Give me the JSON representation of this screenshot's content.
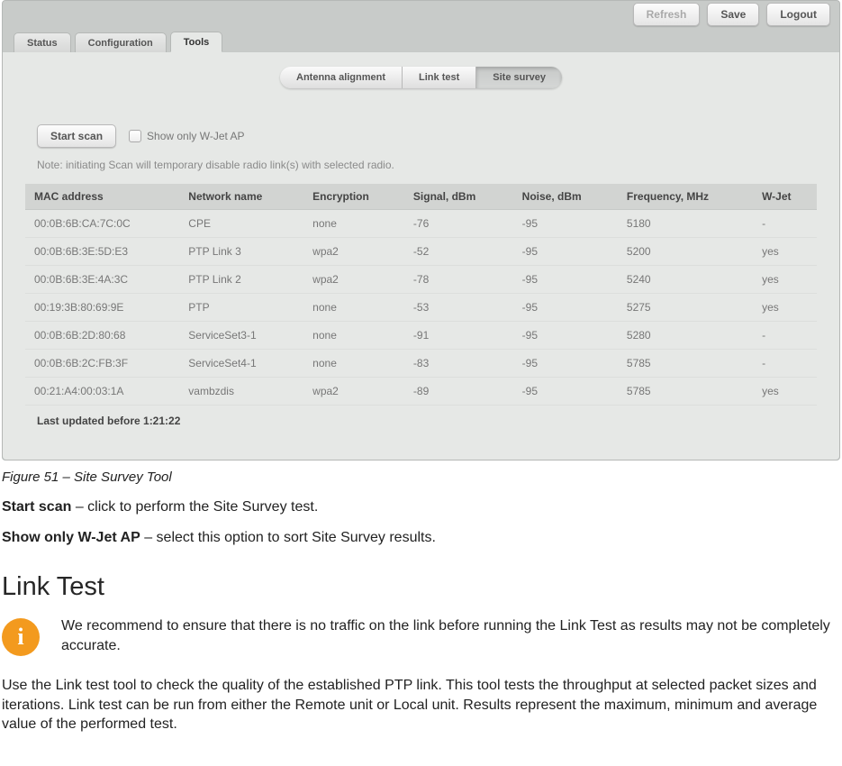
{
  "top_buttons": {
    "refresh": "Refresh",
    "save": "Save",
    "logout": "Logout"
  },
  "main_tabs": {
    "status": "Status",
    "configuration": "Configuration",
    "tools": "Tools"
  },
  "sub_tabs": {
    "antenna": "Antenna alignment",
    "link": "Link test",
    "site": "Site survey"
  },
  "toolbar": {
    "start_scan": "Start scan",
    "show_only_label": "Show only W-Jet AP",
    "note": "Note: initiating Scan will temporary disable radio link(s) with selected radio."
  },
  "headers": {
    "mac": "MAC address",
    "net": "Network name",
    "enc": "Encryption",
    "sig": "Signal, dBm",
    "noise": "Noise, dBm",
    "freq": "Frequency, MHz",
    "wjet": "W-Jet"
  },
  "rows": [
    {
      "mac": "00:0B:6B:CA:7C:0C",
      "net": "CPE",
      "enc": "none",
      "sig": "-76",
      "noise": "-95",
      "freq": "5180",
      "wjet": "-"
    },
    {
      "mac": "00:0B:6B:3E:5D:E3",
      "net": "PTP Link 3",
      "enc": "wpa2",
      "sig": "-52",
      "noise": "-95",
      "freq": "5200",
      "wjet": "yes"
    },
    {
      "mac": "00:0B:6B:3E:4A:3C",
      "net": "PTP Link 2",
      "enc": "wpa2",
      "sig": "-78",
      "noise": "-95",
      "freq": "5240",
      "wjet": "yes"
    },
    {
      "mac": "00:19:3B:80:69:9E",
      "net": "PTP",
      "enc": "none",
      "sig": "-53",
      "noise": "-95",
      "freq": "5275",
      "wjet": "yes"
    },
    {
      "mac": "00:0B:6B:2D:80:68",
      "net": "ServiceSet3-1",
      "enc": "none",
      "sig": "-91",
      "noise": "-95",
      "freq": "5280",
      "wjet": "-"
    },
    {
      "mac": "00:0B:6B:2C:FB:3F",
      "net": "ServiceSet4-1",
      "enc": "none",
      "sig": "-83",
      "noise": "-95",
      "freq": "5785",
      "wjet": "-"
    },
    {
      "mac": "00:21:A4:00:03:1A",
      "net": "vambzdis",
      "enc": "wpa2",
      "sig": "-89",
      "noise": "-95",
      "freq": "5785",
      "wjet": "yes"
    }
  ],
  "last_updated": "Last updated before 1:21:22",
  "caption": "Figure 51 – Site Survey Tool",
  "desc": {
    "start_scan_bold": "Start scan",
    "start_scan_rest": " – click to perform the Site Survey test.",
    "show_bold": "Show only W-Jet AP",
    "show_rest": " – select this option to sort Site Survey results."
  },
  "section_heading": "Link Test",
  "info_text": "We recommend to ensure that there is no traffic on the link before running the Link Test as results may not be completely accurate.",
  "link_test_body": "Use the Link test tool to check the quality of the established PTP link. This tool tests the throughput at selected packet sizes and iterations. Link test can be run from either the Remote unit or Local unit. Results represent the maximum, minimum and average value of the performed test."
}
